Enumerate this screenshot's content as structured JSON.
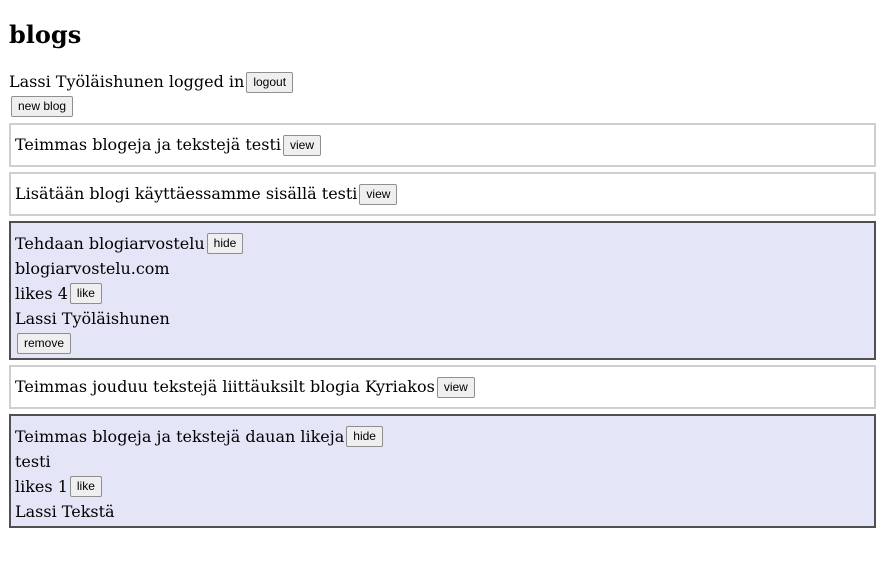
{
  "page": {
    "heading": "blogs"
  },
  "login": {
    "text": "Lassi Työläishunen logged in",
    "logout_label": "logout"
  },
  "new_blog_label": "new blog",
  "blogs": [
    {
      "title": "Teimmas blogeja ja tekstejä testi",
      "toggle_label": "view",
      "expanded": false
    },
    {
      "title": "Lisätään blogi käyttäessamme sisällä testi",
      "toggle_label": "view",
      "expanded": false
    },
    {
      "title": "Tehdaan blogiarvostelu",
      "toggle_label": "hide",
      "expanded": true,
      "url": "blogiarvostelu.com",
      "likes_text": "likes 4",
      "like_label": "like",
      "user": "Lassi Työläishunen",
      "remove_label": "remove"
    },
    {
      "title": "Teimmas jouduu tekstejä liittäuksilt blogia Kyriakos",
      "toggle_label": "view",
      "expanded": false
    },
    {
      "title": "Teimmas blogeja ja tekstejä dauan likeja",
      "toggle_label": "hide",
      "expanded": true,
      "url": "testi",
      "likes_text": "likes 1",
      "like_label": "like",
      "user": "Lassi Tekstä"
    }
  ]
}
